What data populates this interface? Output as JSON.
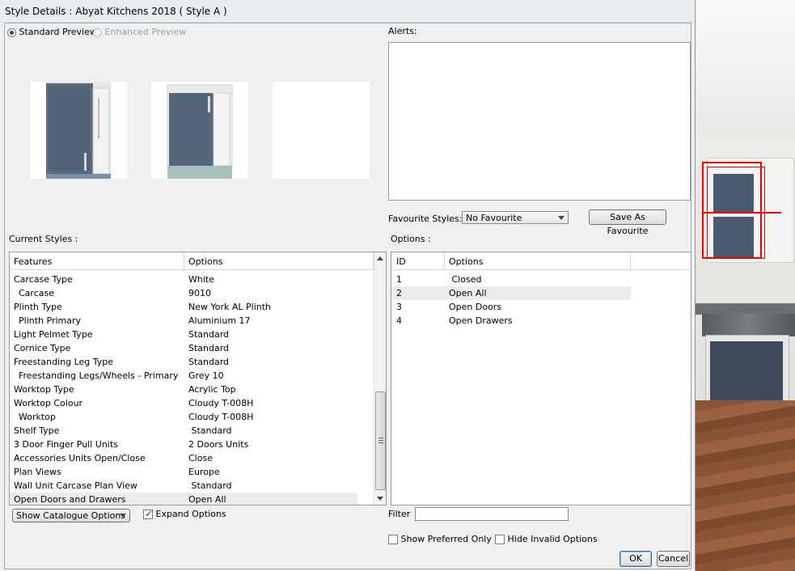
{
  "window": {
    "title": "Style Details : Abyat Kitchens 2018 ( Style A )"
  },
  "preview": {
    "standard_label": "Standard Preview",
    "enhanced_label": "Enhanced Preview",
    "selected": "standard"
  },
  "alerts": {
    "label": "Alerts:"
  },
  "favourite": {
    "label": "Favourite Styles:",
    "selected": "No Favourite",
    "save_button": "Save As Favourite"
  },
  "current_styles": {
    "label": "Current Styles :",
    "columns": [
      "Features",
      "Options"
    ],
    "rows": [
      {
        "feature": "Carcase Type",
        "option": "White",
        "indent": false
      },
      {
        "feature": "Carcase",
        "option": "9010",
        "indent": true
      },
      {
        "feature": "Plinth Type",
        "option": "New York AL Plinth",
        "indent": false
      },
      {
        "feature": "Plinth Primary",
        "option": "Aluminium 17",
        "indent": true
      },
      {
        "feature": "Light Pelmet Type",
        "option": "Standard",
        "indent": false
      },
      {
        "feature": "Cornice Type",
        "option": "Standard",
        "indent": false
      },
      {
        "feature": "Freestanding Leg Type",
        "option": "Standard",
        "indent": false
      },
      {
        "feature": "Freestanding Legs/Wheels - Primary",
        "option": "Grey 10",
        "indent": true
      },
      {
        "feature": "Worktop Type",
        "option": "Acrylic Top",
        "indent": false
      },
      {
        "feature": "Worktop Colour",
        "option": "Cloudy T-008H",
        "indent": false
      },
      {
        "feature": "Worktop",
        "option": "Cloudy T-008H",
        "indent": true
      },
      {
        "feature": "Shelf Type",
        "option": " Standard",
        "indent": false
      },
      {
        "feature": "3 Door Finger Pull Units",
        "option": "2 Doors Units",
        "indent": false
      },
      {
        "feature": "Accessories Units Open/Close",
        "option": "Close",
        "indent": false
      },
      {
        "feature": "Plan Views",
        "option": "Europe",
        "indent": false
      },
      {
        "feature": "Wall Unit Carcase Plan View",
        "option": " Standard",
        "indent": false
      },
      {
        "feature": "Open Doors and Drawers",
        "option": "Open All",
        "indent": false,
        "selected": true
      }
    ]
  },
  "options": {
    "label": "Options :",
    "columns": [
      "ID",
      "Options"
    ],
    "rows": [
      {
        "id": "1",
        "option": " Closed"
      },
      {
        "id": "2",
        "option": "Open All",
        "selected": true
      },
      {
        "id": "3",
        "option": "Open Doors"
      },
      {
        "id": "4",
        "option": "Open Drawers"
      }
    ]
  },
  "bottom": {
    "show_catalogue": "Show Catalogue Options",
    "expand_options": "Expand Options",
    "expand_checked": true,
    "filter_label": "Filter",
    "filter_value": "",
    "show_preferred": "Show Preferred Only",
    "hide_invalid": "Hide Invalid Options",
    "ok": "OK",
    "cancel": "Cancel"
  },
  "colors": {
    "row_selected": "#ececec",
    "accent": "#2b4c7e",
    "scene_red": "#ee0000"
  }
}
